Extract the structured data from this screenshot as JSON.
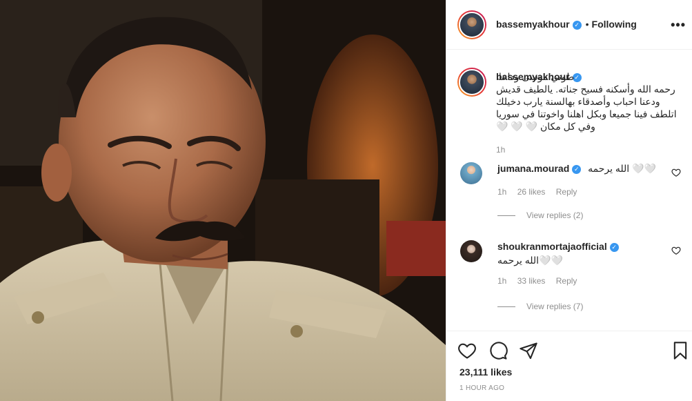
{
  "post": {
    "username": "bassemyakhour",
    "follow_status": "Following",
    "more_icon": "more-options-icon"
  },
  "caption": {
    "username": "bassemyakhour",
    "text": "طوني موسى وداعا. رحمه الله وأسكنه فسيح جناته. يالطيف قديش ودعنا احباب وأصدقاء بهالسنة يارب دخيلك اتلطف فينا جميعا وبكل اهلنا واخوتنا في سوريا وفي كل مكان 🤍 🤍 🤍",
    "time": "1h"
  },
  "comments": [
    {
      "username": "jumana.mourad",
      "text": "الله يرحمه 🤍🤍",
      "time": "1h",
      "likes": "26 likes",
      "reply_label": "Reply",
      "view_replies": "View replies (2)",
      "avatar_color": "#6fa8c8"
    },
    {
      "username": "shoukranmortajaofficial",
      "text": "الله يرحمه🤍🤍",
      "time": "1h",
      "likes": "33 likes",
      "reply_label": "Reply",
      "view_replies": "View replies (7)",
      "avatar_color": "#7a6a62"
    }
  ],
  "actions": {
    "likes_count": "23,111 likes",
    "time_ago": "1 HOUR AGO"
  },
  "colors": {
    "accent": "#3897f0",
    "muted": "#8e8e8e",
    "border": "#efefef"
  }
}
